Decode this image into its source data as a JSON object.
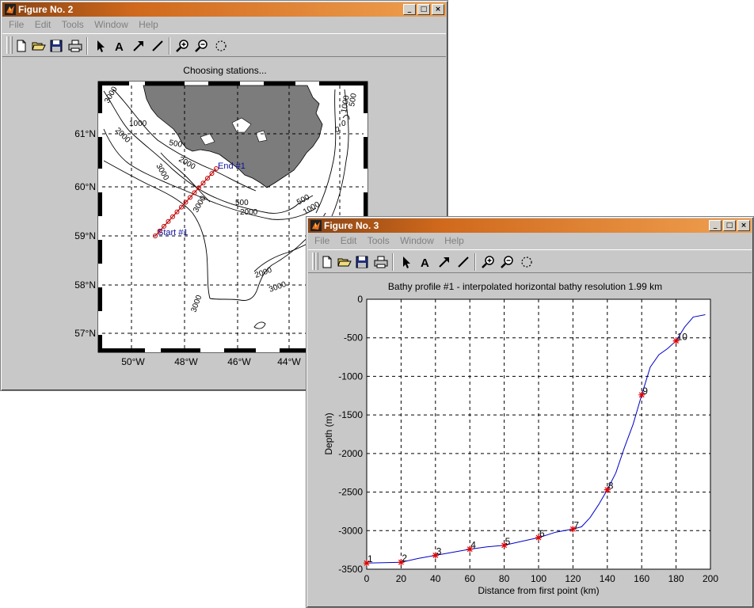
{
  "fig2": {
    "title": "Figure No. 2",
    "menu": [
      "File",
      "Edit",
      "Tools",
      "Window",
      "Help"
    ],
    "plot_title": "Choosing stations...",
    "lat_labels": [
      "61°N",
      "60°N",
      "59°N",
      "58°N",
      "57°N"
    ],
    "lon_labels": [
      "50°W",
      "48°W",
      "46°W",
      "44°W"
    ],
    "start_label": "Start #1",
    "end_label": "End #1",
    "contour_labels": [
      "3000",
      "2000",
      "1000",
      "500",
      "3000",
      "2000",
      "2000",
      "500",
      "1000",
      "3000",
      "3000",
      "2000",
      "500",
      "1000",
      "3000",
      "0",
      "0",
      "1000",
      "500"
    ]
  },
  "fig3": {
    "title": "Figure No. 3",
    "menu": [
      "File",
      "Edit",
      "Tools",
      "Window",
      "Help"
    ]
  },
  "icons": [
    "new-icon",
    "open-icon",
    "save-icon",
    "print-icon",
    "pointer-icon",
    "text-icon",
    "arrow-icon",
    "line-icon",
    "zoom-in-icon",
    "zoom-out-icon",
    "rotate-icon"
  ],
  "chart_data": {
    "type": "line",
    "title": "Bathy profile #1 - interpolated horizontal bathy resolution   1.99 km",
    "xlabel": "Distance from first point (km)",
    "ylabel": "Depth (m)",
    "xlim": [
      0,
      200
    ],
    "ylim": [
      -3500,
      0
    ],
    "xticks": [
      0,
      20,
      40,
      60,
      80,
      100,
      120,
      140,
      160,
      180,
      200
    ],
    "yticks": [
      0,
      -500,
      -1000,
      -1500,
      -2000,
      -2500,
      -3000,
      -3500
    ],
    "grid": true,
    "series": [
      {
        "x": [
          0,
          10,
          20,
          30,
          40,
          50,
          60,
          70,
          80,
          90,
          100,
          110,
          120,
          125,
          130,
          135,
          140,
          145,
          150,
          155,
          160,
          165,
          170,
          175,
          180,
          185,
          190,
          197
        ],
        "y": [
          -3420,
          -3415,
          -3410,
          -3360,
          -3320,
          -3280,
          -3240,
          -3210,
          -3190,
          -3140,
          -3090,
          -3020,
          -2980,
          -2950,
          -2830,
          -2660,
          -2470,
          -2250,
          -1920,
          -1620,
          -1240,
          -880,
          -720,
          -640,
          -540,
          -360,
          -230,
          -200
        ]
      }
    ],
    "stations": {
      "x": [
        0,
        20,
        40,
        60,
        80,
        100,
        120,
        140,
        160,
        180
      ],
      "y": [
        -3420,
        -3410,
        -3320,
        -3240,
        -3190,
        -3090,
        -2980,
        -2470,
        -1240,
        -540
      ],
      "labels": [
        "1",
        "2",
        "3",
        "4",
        "5",
        "6",
        "7",
        "8",
        "9",
        "10"
      ]
    }
  }
}
